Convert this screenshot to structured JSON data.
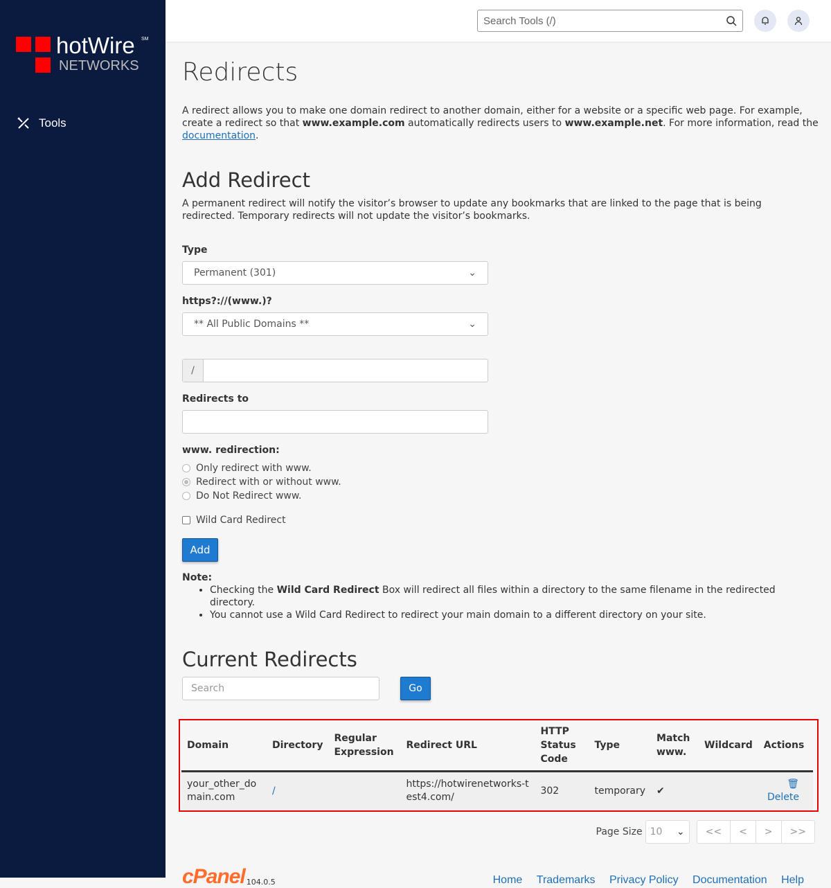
{
  "brand": {
    "name": "hotWire",
    "sm": "SM",
    "sub": "NETWORKS",
    "accent": "#ff0000"
  },
  "sidebar": {
    "items": [
      {
        "label": "Tools",
        "icon": "tools-icon"
      }
    ]
  },
  "header": {
    "search_placeholder": "Search Tools (/)"
  },
  "page": {
    "title": "Redirects",
    "intro": [
      "A redirect allows you to make one domain redirect to another domain, either for a website or a specific web page. For example, create a redirect so that ",
      "www.example.com",
      " automatically redirects users to ",
      "www.example.net",
      ". For more information, read the ",
      "documentation",
      "."
    ]
  },
  "add": {
    "title": "Add Redirect",
    "desc": "A permanent redirect will notify the visitor’s browser to update any bookmarks that are linked to the page that is being redirected. Temporary redirects will not update the visitor’s bookmarks.",
    "type_label": "Type",
    "type_value": "Permanent (301)",
    "domain_label": "https?://(www.)?",
    "domain_value": "** All Public Domains **",
    "path_prefix": "/",
    "redirects_to_label": "Redirects to",
    "www_label": "www. redirection:",
    "www_options": [
      "Only redirect with www.",
      "Redirect with or without www.",
      "Do Not Redirect www."
    ],
    "www_selected": 1,
    "wildcard_label": "Wild Card Redirect",
    "add_button": "Add",
    "note_label": "Note:",
    "notes": [
      [
        "Checking the ",
        "Wild Card Redirect",
        " Box will redirect all files within a directory to the same filename in the redirected directory."
      ],
      [
        "You cannot use a Wild Card Redirect to redirect your main domain to a different directory on your site."
      ]
    ]
  },
  "current": {
    "title": "Current Redirects",
    "search_placeholder": "Search",
    "go": "Go",
    "columns": [
      "Domain",
      "Directory",
      "Regular Expression",
      "Redirect URL",
      "HTTP Status Code",
      "Type",
      "Match www.",
      "Wildcard",
      "Actions"
    ],
    "rows": [
      {
        "domain": "your_other_domain.com",
        "directory": "/",
        "regex": "",
        "url": "https://hotwirenetworks-test4.com/",
        "status": "302",
        "type": "temporary",
        "match_www": true,
        "wildcard": "",
        "action": "Delete"
      }
    ],
    "page_size_label": "Page Size",
    "page_size": "10",
    "pager": [
      "<<",
      "<",
      ">",
      ">>"
    ]
  },
  "footer": {
    "version": "104.0.5",
    "links": [
      "Home",
      "Trademarks",
      "Privacy Policy",
      "Documentation",
      "Help"
    ],
    "brand_color": "#ff6c2c"
  }
}
